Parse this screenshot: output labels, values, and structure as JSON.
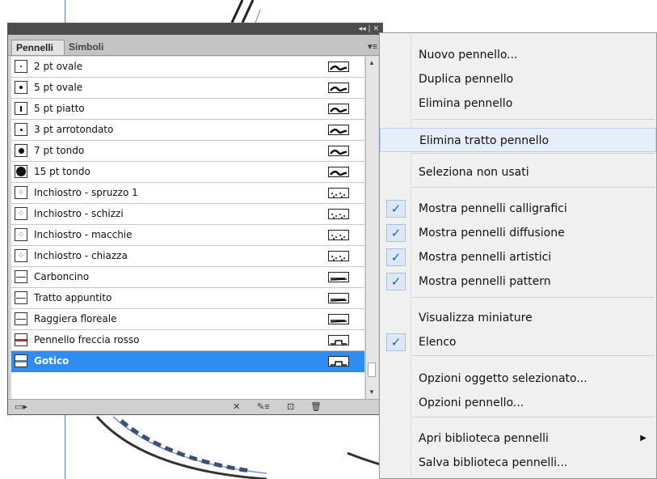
{
  "panel": {
    "tabs": [
      "Pennelli",
      "Simboli"
    ],
    "titlebar_controls": "◂◂ | ✕",
    "menu_button": "▾≡",
    "brushes": [
      {
        "name": "2 pt ovale",
        "kind": "calligraphic"
      },
      {
        "name": "5 pt ovale",
        "kind": "calligraphic"
      },
      {
        "name": "5 pt piatto",
        "kind": "calligraphic"
      },
      {
        "name": "3 pt arrotondato",
        "kind": "calligraphic"
      },
      {
        "name": "7 pt tondo",
        "kind": "calligraphic"
      },
      {
        "name": "15 pt tondo",
        "kind": "calligraphic"
      },
      {
        "name": "Inchiostro - spruzzo 1",
        "kind": "scatter"
      },
      {
        "name": "Inchiostro - schizzi",
        "kind": "scatter"
      },
      {
        "name": "Inchiostro - macchie",
        "kind": "scatter"
      },
      {
        "name": "Inchiostro - chiazza",
        "kind": "scatter"
      },
      {
        "name": "Carboncino",
        "kind": "art"
      },
      {
        "name": "Tratto appuntito",
        "kind": "art"
      },
      {
        "name": "Raggiera floreale",
        "kind": "art"
      },
      {
        "name": "Pennello freccia rosso",
        "kind": "pattern"
      },
      {
        "name": "Gotico",
        "kind": "pattern",
        "selected": true
      }
    ],
    "bottom_icons": [
      "library-menu-icon",
      "remove-stroke-icon",
      "options-icon",
      "new-brush-icon",
      "delete-icon"
    ]
  },
  "menu": {
    "items": [
      {
        "label": "Nuovo pennello...",
        "checked": false
      },
      {
        "label": "Duplica pennello",
        "checked": false
      },
      {
        "label": "Elimina pennello",
        "checked": false
      },
      {
        "label": "Elimina tratto pennello",
        "checked": false,
        "highlighted": true
      },
      {
        "label": "Seleziona non usati",
        "checked": false
      },
      {
        "label": "Mostra pennelli calligrafici",
        "checked": true
      },
      {
        "label": "Mostra pennelli diffusione",
        "checked": true
      },
      {
        "label": "Mostra pennelli artistici",
        "checked": true
      },
      {
        "label": "Mostra pennelli pattern",
        "checked": true
      },
      {
        "label": "Visualizza miniature",
        "checked": false
      },
      {
        "label": "Elenco",
        "checked": true
      },
      {
        "label": "Opzioni oggetto selezionato...",
        "checked": false
      },
      {
        "label": "Opzioni pennello...",
        "checked": false
      },
      {
        "label": "Apri biblioteca pennelli",
        "checked": false,
        "submenu": true
      },
      {
        "label": "Salva biblioteca pennelli...",
        "checked": false
      }
    ],
    "check_glyph": "✓",
    "submenu_glyph": "▶"
  },
  "colors": {
    "selection": "#2f8cf1",
    "panel_bg": "#d6d6d6",
    "menu_bg": "#f0f0f0",
    "guide": "#5b7fd6"
  }
}
